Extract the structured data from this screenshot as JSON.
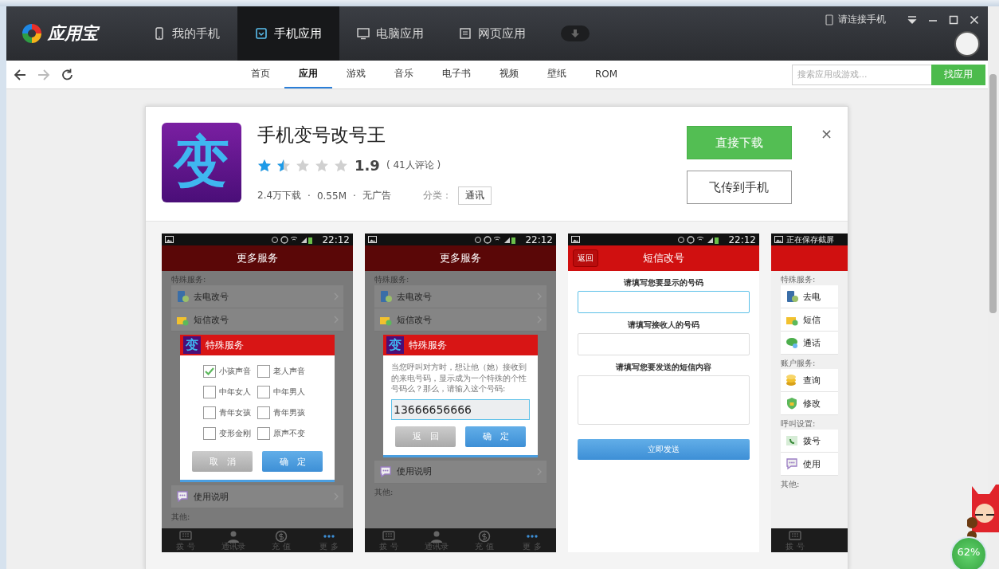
{
  "app_bar": {
    "logo": "应用宝",
    "tabs": [
      {
        "label": "我的手机",
        "selected": false
      },
      {
        "label": "手机应用",
        "selected": true
      },
      {
        "label": "电脑应用",
        "selected": false
      },
      {
        "label": "网页应用",
        "selected": false
      }
    ],
    "connect": "请连接手机"
  },
  "nav": {
    "links": [
      {
        "label": "首页",
        "selected": false
      },
      {
        "label": "应用",
        "selected": true
      },
      {
        "label": "游戏",
        "selected": false
      },
      {
        "label": "音乐",
        "selected": false
      },
      {
        "label": "电子书",
        "selected": false
      },
      {
        "label": "视频",
        "selected": false
      },
      {
        "label": "壁纸",
        "selected": false
      },
      {
        "label": "ROM",
        "selected": false
      }
    ],
    "search": {
      "placeholder": "搜索应用或游戏...",
      "button": "找应用"
    }
  },
  "app": {
    "icon_glyph": "变",
    "name": "手机变号改号王",
    "stars": 1.5,
    "rating": "1.9",
    "reviews": "( 41人评论 )",
    "meta": [
      "2.4万下载",
      "·",
      "0.55M",
      "·",
      "无广告"
    ],
    "category_label": "分类：",
    "category": "通讯",
    "buttons": [
      {
        "label": "直接下载",
        "kind": "primary"
      },
      {
        "label": "飞传到手机",
        "kind": "secondary"
      }
    ],
    "close": "×"
  },
  "screenshots": [
    {
      "status": {
        "time": "22:12"
      },
      "header": {
        "title": "更多服务"
      },
      "dimmed": true,
      "blocks": [
        {
          "kind": "heading",
          "text": "特殊服务:"
        },
        {
          "kind": "item",
          "text": "去电改号"
        },
        {
          "kind": "item",
          "text": "短信改号"
        },
        {
          "kind": "options-dialog",
          "icon_glyph": "变",
          "title": "特殊服务",
          "options": [
            {
              "label": "小孩声音",
              "checked": true
            },
            {
              "label": "老人声音",
              "checked": false
            },
            {
              "label": "中年女人",
              "checked": false
            },
            {
              "label": "中年男人",
              "checked": false
            },
            {
              "label": "青年女孩",
              "checked": false
            },
            {
              "label": "青年男孩",
              "checked": false
            },
            {
              "label": "变形金刚",
              "checked": false
            },
            {
              "label": "原声不变",
              "checked": false
            }
          ],
          "buttons": [
            {
              "label": "取　消",
              "kind": "cancel"
            },
            {
              "label": "确　定",
              "kind": "confirm"
            }
          ]
        },
        {
          "kind": "item",
          "text": "使用说明"
        },
        {
          "kind": "heading",
          "text": "其他:"
        }
      ],
      "tabbar": [
        "拨 号",
        "通讯录",
        "充 值",
        "更 多"
      ]
    },
    {
      "status": {
        "time": "22:12"
      },
      "header": {
        "title": "更多服务"
      },
      "dimmed": true,
      "blocks": [
        {
          "kind": "heading",
          "text": "特殊服务:"
        },
        {
          "kind": "item",
          "text": "去电改号"
        },
        {
          "kind": "item",
          "text": "短信改号"
        },
        {
          "kind": "input-dialog",
          "icon_glyph": "变",
          "title": "特殊服务",
          "message": "当您呼叫对方时，想让他（她）接收到的来电号码，显示成为一个特殊的个性号码么？那么，请输入这个号码:",
          "value": "13666656666",
          "buttons": [
            {
              "label": "返　回",
              "kind": "cancel"
            },
            {
              "label": "确　定",
              "kind": "confirm"
            }
          ]
        },
        {
          "kind": "item",
          "text": "使用说明"
        },
        {
          "kind": "heading",
          "text": "其他:"
        }
      ],
      "tabbar": [
        "拨 号",
        "通讯录",
        "充 值",
        "更 多"
      ]
    },
    {
      "status": {
        "time": "22:12"
      },
      "header": {
        "title": "短信改号",
        "back": "返回"
      },
      "dimmed": false,
      "blocks": [
        {
          "kind": "field-label",
          "text": "请填写您要显示的号码"
        },
        {
          "kind": "field",
          "focused": true
        },
        {
          "kind": "field-label",
          "text": "请填写接收人的号码"
        },
        {
          "kind": "field",
          "focused": false
        },
        {
          "kind": "field-label",
          "text": "请填写您要发送的短信内容"
        },
        {
          "kind": "textarea",
          "focused": false
        },
        {
          "kind": "send-button",
          "text": "立即发送"
        }
      ]
    },
    {
      "status": {
        "notice": "正在保存截屏"
      },
      "dimmed": false,
      "blocks": [
        {
          "kind": "heading",
          "text": "特殊服务:"
        },
        {
          "kind": "item",
          "text": "去电"
        },
        {
          "kind": "item",
          "text": "短信"
        },
        {
          "kind": "item",
          "text": "通话"
        },
        {
          "kind": "heading",
          "text": "账户服务:"
        },
        {
          "kind": "item",
          "text": "查询"
        },
        {
          "kind": "item",
          "text": "修改"
        },
        {
          "kind": "heading",
          "text": "呼叫设置:"
        },
        {
          "kind": "item",
          "text": "拨号"
        },
        {
          "kind": "item",
          "text": "使用"
        },
        {
          "kind": "heading",
          "text": "其他:"
        }
      ],
      "tabbar": [
        "拨 号"
      ]
    }
  ],
  "widget": {
    "percent": "62%"
  }
}
